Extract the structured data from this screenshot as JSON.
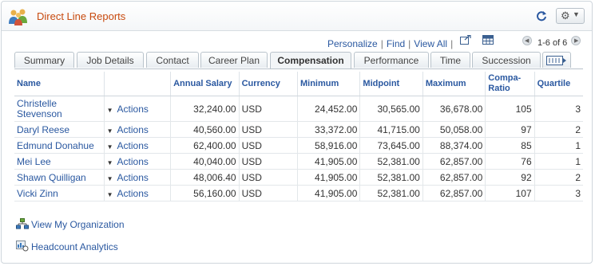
{
  "title": "Direct Line Reports",
  "toolbar": {
    "personalize": "Personalize",
    "find": "Find",
    "view_all": "View All",
    "pager": "1-6 of 6"
  },
  "tabs": [
    "Summary",
    "Job Details",
    "Contact",
    "Career Plan",
    "Compensation",
    "Performance",
    "Time",
    "Succession"
  ],
  "active_tab": "Compensation",
  "columns": [
    "Name",
    "",
    "Annual Salary",
    "Currency",
    "Minimum",
    "Midpoint",
    "Maximum",
    "Compa-Ratio",
    "Quartile"
  ],
  "columns_split": {
    "compa_1": "Compa-",
    "compa_2": "Ratio"
  },
  "actions_label": "Actions",
  "rows": [
    {
      "name_1": "Christelle",
      "name_2": "Stevenson",
      "salary": "32,240.00",
      "currency": "USD",
      "min": "24,452.00",
      "mid": "30,565.00",
      "max": "36,678.00",
      "ratio": "105",
      "quartile": "3"
    },
    {
      "name_1": "Daryl Reese",
      "name_2": "",
      "salary": "40,560.00",
      "currency": "USD",
      "min": "33,372.00",
      "mid": "41,715.00",
      "max": "50,058.00",
      "ratio": "97",
      "quartile": "2"
    },
    {
      "name_1": "Edmund Donahue",
      "name_2": "",
      "salary": "62,400.00",
      "currency": "USD",
      "min": "58,916.00",
      "mid": "73,645.00",
      "max": "88,374.00",
      "ratio": "85",
      "quartile": "1"
    },
    {
      "name_1": "Mei Lee",
      "name_2": "",
      "salary": "40,040.00",
      "currency": "USD",
      "min": "41,905.00",
      "mid": "52,381.00",
      "max": "62,857.00",
      "ratio": "76",
      "quartile": "1"
    },
    {
      "name_1": "Shawn Quilligan",
      "name_2": "",
      "salary": "48,006.40",
      "currency": "USD",
      "min": "41,905.00",
      "mid": "52,381.00",
      "max": "62,857.00",
      "ratio": "92",
      "quartile": "2"
    },
    {
      "name_1": "Vicki Zinn",
      "name_2": "",
      "salary": "56,160.00",
      "currency": "USD",
      "min": "41,905.00",
      "mid": "52,381.00",
      "max": "62,857.00",
      "ratio": "107",
      "quartile": "3"
    }
  ],
  "footer": {
    "view_org": "View My Organization",
    "headcount": "Headcount Analytics"
  },
  "colors": {
    "title": "#c84a0e",
    "link": "#2a58a0"
  }
}
